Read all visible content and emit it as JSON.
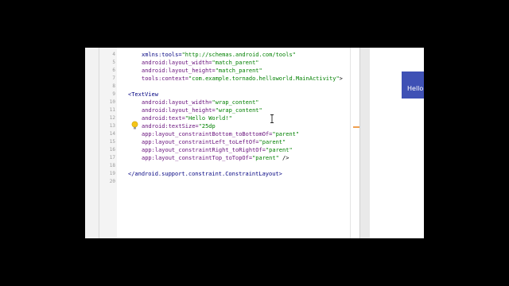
{
  "editor": {
    "gutter_numbers": [
      "4",
      "5",
      "6",
      "7",
      "8",
      "9",
      "10",
      "11",
      "12",
      "13",
      "14",
      "15",
      "16",
      "17",
      "18",
      "19",
      "20"
    ],
    "lines": [
      [
        {
          "c": "t",
          "v": "xmlns:tools="
        },
        {
          "c": "s",
          "v": "\"http://schemas.android.com/tools\""
        }
      ],
      [
        {
          "c": "a",
          "v": "android:layout_width="
        },
        {
          "c": "s",
          "v": "\"match_parent\""
        }
      ],
      [
        {
          "c": "a",
          "v": "android:layout_height="
        },
        {
          "c": "s",
          "v": "\"match_parent\""
        }
      ],
      [
        {
          "c": "a",
          "v": "tools:context="
        },
        {
          "c": "s",
          "v": "\"com.example.tornado.helloworld.MainActivity\""
        },
        {
          "c": "p",
          "v": ">"
        }
      ],
      [],
      [
        {
          "c": "t",
          "v": "<TextView"
        }
      ],
      [
        {
          "c": "a",
          "v": "android:layout_width="
        },
        {
          "c": "s",
          "v": "\"wrap_content\""
        }
      ],
      [
        {
          "c": "a",
          "v": "android:layout_height="
        },
        {
          "c": "s",
          "v": "\"wrap_content\""
        }
      ],
      [
        {
          "c": "a",
          "v": "android:text="
        },
        {
          "c": "s",
          "v": "\"Hello World!\""
        }
      ],
      [
        {
          "c": "a",
          "v": "android:textSize="
        },
        {
          "c": "s",
          "v": "\"25dp"
        }
      ],
      [
        {
          "c": "a",
          "v": "app:layout_constraintBottom_toBottomOf="
        },
        {
          "c": "s",
          "v": "\"parent\""
        }
      ],
      [
        {
          "c": "a",
          "v": "app:layout_constraintLeft_toLeftOf="
        },
        {
          "c": "s",
          "v": "\"parent\""
        }
      ],
      [
        {
          "c": "a",
          "v": "app:layout_constraintRight_toRightOf="
        },
        {
          "c": "s",
          "v": "\"parent\""
        }
      ],
      [
        {
          "c": "a",
          "v": "app:layout_constraintTop_toTopOf="
        },
        {
          "c": "s",
          "v": "\"parent\""
        },
        {
          "c": "p",
          "v": " />"
        }
      ],
      [],
      [
        {
          "c": "t",
          "v": "</android.support.constraint.ConstraintLayout>"
        }
      ],
      []
    ]
  },
  "preview": {
    "title": "Hello"
  },
  "colors": {
    "accent": "#3f51b5",
    "string": "#008000",
    "attribute": "#660e7a",
    "tag": "#000080"
  }
}
